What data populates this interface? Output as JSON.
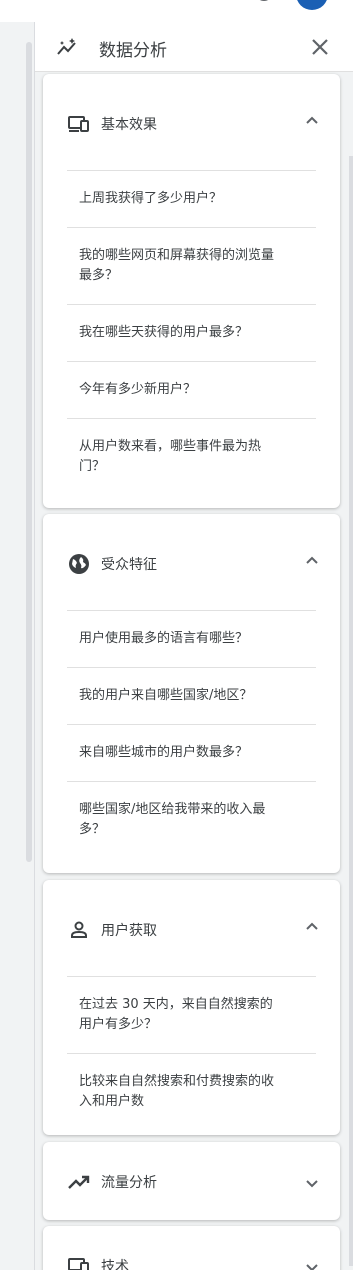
{
  "panel": {
    "title": "数据分析"
  },
  "colors": {
    "avatar": "#1a5fb4",
    "panel_bg": "#f1f3f4",
    "card_bg": "#ffffff"
  },
  "categories": [
    {
      "label": "基本效果",
      "icon": "devices-icon",
      "expanded": true,
      "questions": [
        "上周我获得了多少用户？",
        "我的哪些网页和屏幕获得的浏览量最多？",
        "我在哪些天获得的用户最多？",
        "今年有多少新用户？",
        "从用户数来看，哪些事件最为热门？"
      ]
    },
    {
      "label": "受众特征",
      "icon": "globe-icon",
      "expanded": true,
      "questions": [
        "用户使用最多的语言有哪些？",
        "我的用户来自哪些国家/地区？",
        "来自哪些城市的用户数最多？",
        "哪些国家/地区给我带来的收入最多？"
      ]
    },
    {
      "label": "用户获取",
      "icon": "person-icon",
      "expanded": true,
      "questions": [
        "在过去 30 天内，来自自然搜索的用户有多少？",
        "比较来自自然搜索和付费搜索的收入和用户数"
      ]
    },
    {
      "label": "流量分析",
      "icon": "trending-up-icon",
      "expanded": false,
      "questions": []
    },
    {
      "label": "技术",
      "icon": "devices-icon",
      "expanded": false,
      "questions": []
    }
  ]
}
